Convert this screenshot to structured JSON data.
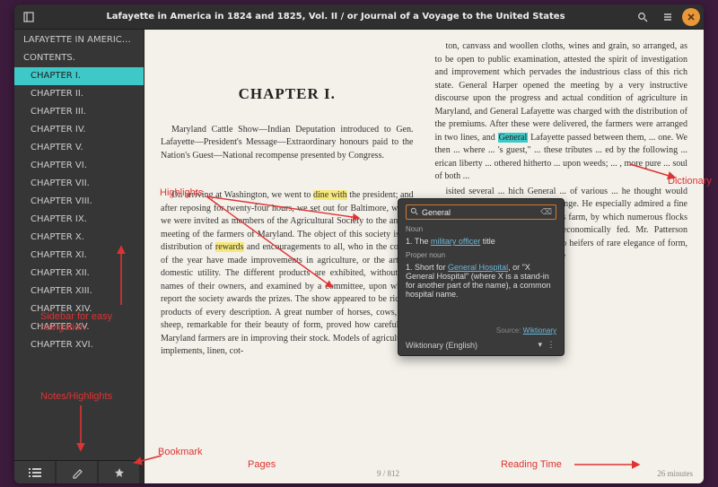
{
  "titlebar": {
    "title": "Lafayette in America in 1824 and 1825, Vol. II / or Journal of a Voyage to the United States"
  },
  "sidebar": {
    "items": [
      {
        "label": "LAFAYETTE IN AMERICA IN 1824 ...",
        "depth": 0
      },
      {
        "label": "CONTENTS.",
        "depth": 0
      },
      {
        "label": "CHAPTER I.",
        "depth": 1,
        "active": true
      },
      {
        "label": "CHAPTER II.",
        "depth": 1
      },
      {
        "label": "CHAPTER III.",
        "depth": 1
      },
      {
        "label": "CHAPTER IV.",
        "depth": 1
      },
      {
        "label": "CHAPTER V.",
        "depth": 1
      },
      {
        "label": "CHAPTER VI.",
        "depth": 1
      },
      {
        "label": "CHAPTER VII.",
        "depth": 1
      },
      {
        "label": "CHAPTER VIII.",
        "depth": 1
      },
      {
        "label": "CHAPTER IX.",
        "depth": 1
      },
      {
        "label": "CHAPTER X.",
        "depth": 1
      },
      {
        "label": "CHAPTER XI.",
        "depth": 1
      },
      {
        "label": "CHAPTER XII.",
        "depth": 1
      },
      {
        "label": "CHAPTER XIII.",
        "depth": 1
      },
      {
        "label": "CHAPTER XIV.",
        "depth": 1
      },
      {
        "label": "CHAPTER XV.",
        "depth": 1
      },
      {
        "label": "CHAPTER XVI.",
        "depth": 1
      }
    ]
  },
  "content": {
    "chapter_title": "CHAPTER I.",
    "intro": "Maryland Cattle Show—Indian Deputation introduced to Gen. Lafayette—President's Message—Extraordinary honours paid to the Nation's Guest—National recompense presented by Congress.",
    "col1_pre": "On arriving at Washington, we went to ",
    "hl1": "dine with",
    "col1_mid": " the president; and after reposing for twenty-four hours, we set out for Baltimore, where we were invited as members of the Agricultural Society to the annual meeting of the farmers of Maryland. The object of this society is the distribution of ",
    "hl2": "rewards",
    "col1_post": " and encouragements to all, who in the course of the year have made improvements in agriculture, or the arts of domestic utility. The different products are exhibited, without the names of their owners, and examined by a committee, upon whose report the society awards the prizes. The show appeared to be rich in products of every description. A great number of horses, cows, and sheep, remarkable for their beauty of form, proved how careful the Maryland farmers are in improving their stock. Models of agricultural implements, linen, cot-",
    "col2_pre": "ton, canvass and woollen cloths, wines and grain, so arranged, as to be open to public examination, attested the spirit of investigation and improvement which pervades the industrious class of this rich state. General Harper opened the meeting by a very instructive discourse upon the progress and actual condition of agriculture in Maryland, and General Lafayette was charged with the distribution of the premiums. After these were delivered, the farmers were arranged in two lines, and ",
    "hl3": "General",
    "col2_mid": " Lafayette passed between them, ... one. We then ... where ... 's guest,\" ... these tributes ... ed by the following ... erican liberty ... othered hitherto ... upon weeds; ... , more pure ... soul of both ...",
    "col2_tail": "isited several ... hich General ... of various ... he thought would prove useful on his farm at La Grange. He especially admired a fine steam boiler,[1] at General Harper's farm, by which numerous flocks could be more abundantly and economically fed. Mr. Patterson presented him a young bull and two heifers of rare elegance of form, said to be of the English Devonshire"
  },
  "footer": {
    "pages_label": "Pages",
    "pages": "9 / 812",
    "time": "26 minutes"
  },
  "dictionary": {
    "query": "General",
    "noun_label": "Noun",
    "noun_def_prefix": "1. The ",
    "noun_def_link": "military officer",
    "noun_def_suffix": " title",
    "pn_label": "Proper noun",
    "pn_def_prefix": "1. Short for ",
    "pn_def_link": "General Hospital",
    "pn_def_suffix": ", or \"X General Hospital\" (where X is a stand-in for another part of the name), a common hospital name.",
    "source_label": "Source: ",
    "source_link": "Wiktionary",
    "provider": "Wiktionary (English)"
  },
  "annotations": {
    "highlights": "Highlights",
    "sidebar_nav": "Sidebar for easy navigation",
    "notes": "Notes/Highlights",
    "bookmark": "Bookmark",
    "pages": "Pages",
    "reading_time": "Reading Time",
    "dictionary": "Dictionary"
  }
}
